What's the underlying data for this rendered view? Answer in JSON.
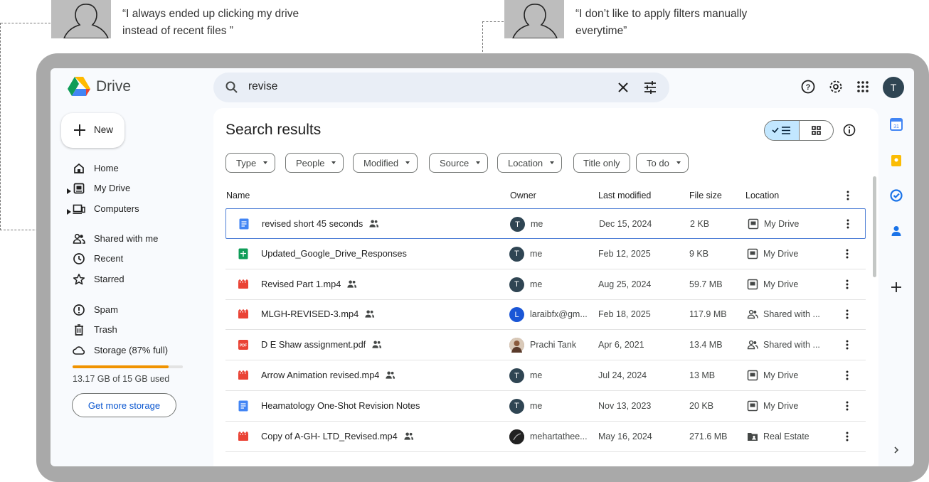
{
  "annotations": {
    "quote_left": [
      "“I always ended up clicking my drive",
      "instead of recent files ”"
    ],
    "quote_right": [
      "“I don’t like to apply filters manually",
      "everytime”"
    ]
  },
  "app": {
    "name": "Drive",
    "user_initial": "T"
  },
  "search": {
    "query": "revise",
    "icons": [
      "search-icon",
      "close-icon",
      "tune-icon"
    ]
  },
  "top_icons": [
    "help-icon",
    "settings-icon",
    "apps-grid-icon"
  ],
  "sidebar": {
    "new_label": "New",
    "items": [
      {
        "label": "Home",
        "icon": "home-icon",
        "expandable": false
      },
      {
        "label": "My Drive",
        "icon": "my-drive-icon",
        "expandable": true
      },
      {
        "label": "Computers",
        "icon": "computers-icon",
        "expandable": true
      },
      {
        "label": "Shared with me",
        "icon": "shared-icon",
        "expandable": false
      },
      {
        "label": "Recent",
        "icon": "clock-icon",
        "expandable": false
      },
      {
        "label": "Starred",
        "icon": "star-icon",
        "expandable": false
      },
      {
        "label": "Spam",
        "icon": "spam-icon",
        "expandable": false
      },
      {
        "label": "Trash",
        "icon": "trash-icon",
        "expandable": false
      },
      {
        "label": "Storage (87% full)",
        "icon": "cloud-icon",
        "expandable": false
      }
    ],
    "storage_used_fraction": 0.87,
    "storage_text": "13.17 GB of 15 GB used",
    "get_storage_label": "Get more storage"
  },
  "main": {
    "title": "Search results",
    "filters": [
      "Type",
      "People",
      "Modified",
      "Source",
      "Location",
      "Title only",
      "To do"
    ],
    "columns": [
      "Name",
      "Owner",
      "Last modified",
      "File size",
      "Location"
    ],
    "rows": [
      {
        "name": "revised short 45 seconds",
        "type": "doc",
        "shared": true,
        "owner": "me",
        "owner_initial": "T",
        "owner_color": "#2f4553",
        "modified": "Dec 15, 2024",
        "size": "2 KB",
        "location": "My Drive",
        "loc_icon": "drive"
      },
      {
        "name": "Updated_Google_Drive_Responses",
        "type": "sheet",
        "shared": false,
        "owner": "me",
        "owner_initial": "T",
        "owner_color": "#2f4553",
        "modified": "Feb 12, 2025",
        "size": "9 KB",
        "location": "My Drive",
        "loc_icon": "drive"
      },
      {
        "name": "Revised Part 1.mp4",
        "type": "video",
        "shared": true,
        "owner": "me",
        "owner_initial": "T",
        "owner_color": "#2f4553",
        "modified": "Aug 25, 2024",
        "size": "59.7 MB",
        "location": "My Drive",
        "loc_icon": "drive"
      },
      {
        "name": "MLGH-REVISED-3.mp4",
        "type": "video",
        "shared": true,
        "owner": "laraibfx@gm...",
        "owner_initial": "L",
        "owner_color": "#1a56d6",
        "modified": "Feb 18, 2025",
        "size": "117.9 MB",
        "location": "Shared with ...",
        "loc_icon": "shared"
      },
      {
        "name": "D E Shaw assignment.pdf",
        "type": "pdf",
        "shared": true,
        "owner": "Prachi Tank",
        "owner_initial": "",
        "owner_color": "#8a6a55",
        "modified": "Apr 6, 2021",
        "size": "13.4 MB",
        "location": "Shared with ...",
        "loc_icon": "shared"
      },
      {
        "name": "Arrow Animation revised.mp4",
        "type": "video",
        "shared": true,
        "owner": "me",
        "owner_initial": "T",
        "owner_color": "#2f4553",
        "modified": "Jul 24, 2024",
        "size": "13 MB",
        "location": "My Drive",
        "loc_icon": "drive"
      },
      {
        "name": "Heamatology One-Shot Revision Notes",
        "type": "doc",
        "shared": false,
        "owner": "me",
        "owner_initial": "T",
        "owner_color": "#2f4553",
        "modified": "Nov 13, 2023",
        "size": "20 KB",
        "location": "My Drive",
        "loc_icon": "drive"
      },
      {
        "name": "Copy of A-GH- LTD_Revised.mp4",
        "type": "video",
        "shared": true,
        "owner": "mehartathee...",
        "owner_initial": "",
        "owner_color": "#222222",
        "modified": "May 16, 2024",
        "size": "271.6 MB",
        "location": "Real Estate",
        "loc_icon": "folder"
      }
    ]
  },
  "right_rail": [
    "calendar-icon",
    "keep-icon",
    "tasks-icon",
    "contacts-icon",
    "add-icon",
    "chevron-right-icon"
  ],
  "colors": {
    "accent_blue": "#0b57d0",
    "storage_orange": "#f09300",
    "selected_chip": "#c2e7ff"
  }
}
